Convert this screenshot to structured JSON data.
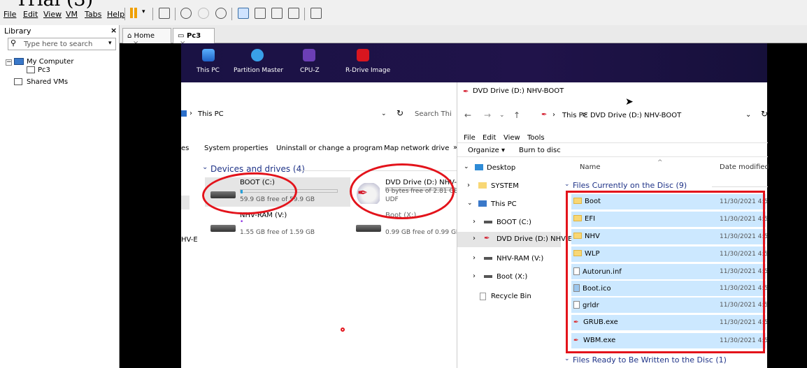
{
  "title_overlay": "Trial (3)",
  "menu": [
    "File",
    "Edit",
    "View",
    "VM",
    "Tabs",
    "Help"
  ],
  "library": {
    "header": "Library",
    "close": "×",
    "search_placeholder": "Type here to search",
    "tree": [
      "My Computer",
      "Pc3",
      "Shared VMs"
    ]
  },
  "tabs": [
    {
      "label": "Home",
      "close": "×"
    },
    {
      "label": "Pc3",
      "close": "×"
    }
  ],
  "desktop_icons": [
    "This PC",
    "Partition Master",
    "CPU-Z",
    "R-Drive Image"
  ],
  "this_pc": {
    "address": "This PC",
    "search": "Search Thi",
    "ribbon": [
      "es",
      "System properties",
      "Uninstall or change a program",
      "Map network drive",
      "»"
    ],
    "section": "Devices and drives (4)",
    "partial_label": "HV-E",
    "drives": [
      {
        "name": "BOOT (C:)",
        "detail": "59.9 GB free of 59.9 GB",
        "fill": 0.02
      },
      {
        "name": "DVD Drive (D:) NHV-BOOT",
        "detail": "0 bytes free of 2.81 GB",
        "extra": "UDF",
        "fill": 1.0
      },
      {
        "name": "NHV-RAM (V:)",
        "detail": "1.55 GB free of 1.59 GB",
        "fill": 0.03
      },
      {
        "name": "Boot (X:)",
        "detail": "0.99 GB free of 0.99 GB",
        "fill": 0.01
      }
    ]
  },
  "dvd_window": {
    "title": "DVD Drive (D:) NHV-BOOT",
    "breadcrumb": [
      "This PC",
      ">",
      "DVD Drive (D:) NHV-BOOT"
    ],
    "menu": [
      "File",
      "Edit",
      "View",
      "Tools"
    ],
    "toolbar": [
      "Organize ▾",
      "Burn to disc"
    ],
    "nav": [
      "Desktop",
      "SYSTEM",
      "This PC",
      "BOOT (C:)",
      "DVD Drive (D:) NHV-E",
      "NHV-RAM (V:)",
      "Boot (X:)",
      "Recycle Bin"
    ],
    "col_name": "Name",
    "col_date": "Date modified",
    "group_current": "Files Currently on the Disc (9)",
    "group_ready": "Files Ready to Be Written to the Disc (1)",
    "files": [
      {
        "name": "Boot",
        "type": "folder",
        "date": "11/30/2021 4:5"
      },
      {
        "name": "EFI",
        "type": "folder",
        "date": "11/30/2021 4:5"
      },
      {
        "name": "NHV",
        "type": "folder",
        "date": "11/30/2021 4:5"
      },
      {
        "name": "WLP",
        "type": "folder",
        "date": "11/30/2021 4:5"
      },
      {
        "name": "Autorun.inf",
        "type": "file",
        "date": "11/30/2021 4:5"
      },
      {
        "name": "Boot.ico",
        "type": "file",
        "date": "11/30/2021 4:5"
      },
      {
        "name": "grldr",
        "type": "file",
        "date": "11/30/2021 4:5"
      },
      {
        "name": "GRUB.exe",
        "type": "exe",
        "date": "11/30/2021 4:5"
      },
      {
        "name": "WBM.exe",
        "type": "exe",
        "date": "11/30/2021 4:5"
      }
    ]
  },
  "colors": {
    "highlight": "#e3131b",
    "selection": "#cce8ff",
    "accent": "#26a0da"
  }
}
